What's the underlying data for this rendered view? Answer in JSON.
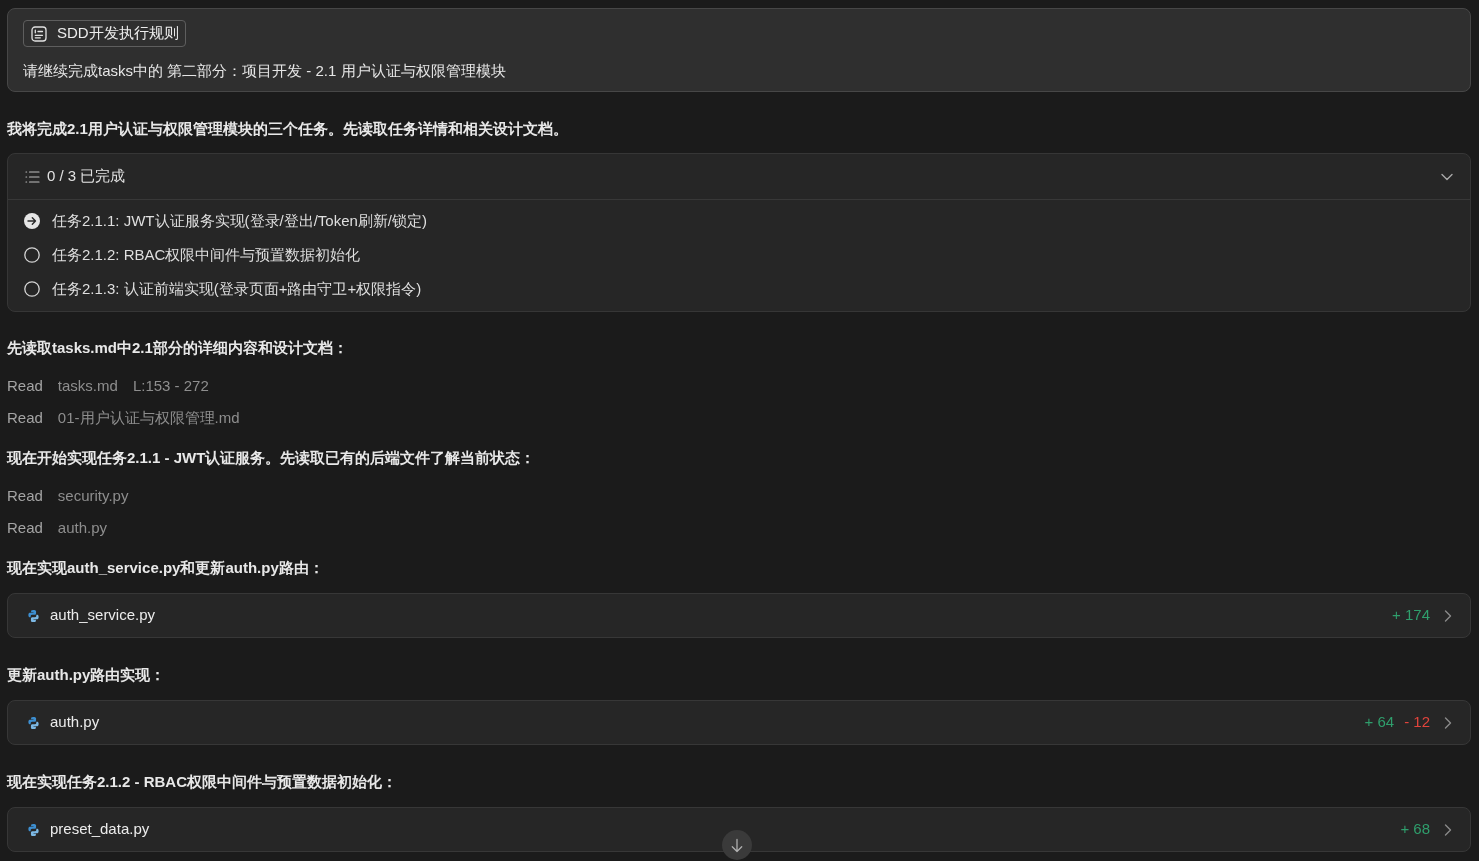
{
  "user_message": {
    "rule_chip": "SDD开发执行规则",
    "text": "请继续完成tasks中的 第二部分：项目开发 - 2.1 用户认证与权限管理模块"
  },
  "conversation": [
    {
      "kind": "paragraph",
      "text": "我将完成2.1用户认证与权限管理模块的三个任务。先读取任务详情和相关设计文档。"
    },
    {
      "kind": "todo",
      "summary": "0 / 3 已完成",
      "expanded": true,
      "tasks": [
        {
          "label": "任务2.1.1: JWT认证服务实现(登录/登出/Token刷新/锁定)",
          "in_progress": true
        },
        {
          "label": "任务2.1.2: RBAC权限中间件与预置数据初始化",
          "in_progress": false
        },
        {
          "label": "任务2.1.3: 认证前端实现(登录页面+路由守卫+权限指令)",
          "in_progress": false
        }
      ]
    },
    {
      "kind": "paragraph",
      "text": "先读取tasks.md中2.1部分的详细内容和设计文档："
    },
    {
      "kind": "read",
      "label": "Read",
      "file": "tasks.md",
      "range": "L:153 - 272"
    },
    {
      "kind": "read",
      "label": "Read",
      "file": "01-用户认证与权限管理.md"
    },
    {
      "kind": "paragraph",
      "text": "现在开始实现任务2.1.1 - JWT认证服务。先读取已有的后端文件了解当前状态："
    },
    {
      "kind": "read",
      "label": "Read",
      "file": "security.py"
    },
    {
      "kind": "read",
      "label": "Read",
      "file": "auth.py"
    },
    {
      "kind": "paragraph",
      "text": "现在实现auth_service.py和更新auth.py路由："
    },
    {
      "kind": "file_edit",
      "file": "auth_service.py",
      "added": "+ 174"
    },
    {
      "kind": "paragraph",
      "text": "更新auth.py路由实现："
    },
    {
      "kind": "file_edit",
      "file": "auth.py",
      "added": "+ 64",
      "removed": "- 12"
    },
    {
      "kind": "paragraph",
      "text": "现在实现任务2.1.2 - RBAC权限中间件与预置数据初始化："
    },
    {
      "kind": "file_edit",
      "file": "preset_data.py",
      "added": "+ 68"
    }
  ]
}
